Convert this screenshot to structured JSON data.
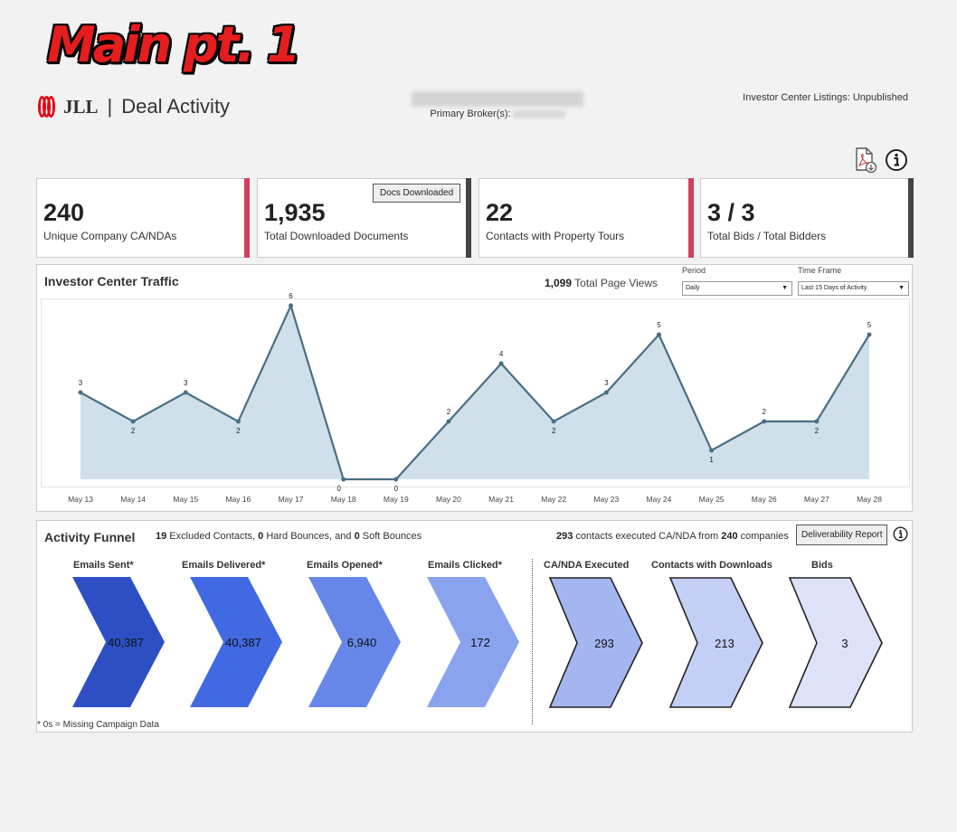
{
  "banner": "Main pt. 1",
  "header": {
    "logo_text": "JLL",
    "separator": "|",
    "title": "Deal Activity",
    "broker_label": "Primary Broker(s):",
    "listing_status": "Investor Center Listings: Unpublished"
  },
  "icons": {
    "pdf": "pdf-export-icon",
    "info": "info-icon"
  },
  "kpis": [
    {
      "value": "240",
      "label": "Unique Company CA/NDAs",
      "accent": "#d43f5e"
    },
    {
      "value": "1,935",
      "label": "Total Downloaded Documents",
      "accent": "#444444",
      "button": "Docs Downloaded"
    },
    {
      "value": "22",
      "label": "Contacts with Property Tours",
      "accent": "#d43f5e"
    },
    {
      "value": "3 / 3",
      "label": "Total Bids / Total Bidders",
      "accent": "#444444"
    }
  ],
  "traffic": {
    "title": "Investor Center Traffic",
    "views_value": "1,099",
    "views_label": "Total Page Views",
    "period_label": "Period",
    "period_value": "Daily",
    "timeframe_label": "Time Frame",
    "timeframe_value": "Last 15 Days of Activity"
  },
  "chart_data": {
    "type": "area",
    "x": [
      "May 13",
      "May 14",
      "May 15",
      "May 16",
      "May 17",
      "May 18",
      "May 19",
      "May 20",
      "May 21",
      "May 22",
      "May 23",
      "May 24",
      "May 25",
      "May 26",
      "May 27",
      "May 28"
    ],
    "values": [
      3,
      2,
      3,
      2,
      6,
      0,
      0,
      2,
      4,
      2,
      3,
      5,
      1,
      2,
      2,
      5
    ],
    "ylim": [
      0,
      6
    ],
    "grid": false,
    "line_color": "#4a6f82",
    "fill_color": "#cfe0ea"
  },
  "funnel": {
    "title": "Activity Funnel",
    "exclusions": {
      "excluded": "19",
      "excluded_text": " Excluded Contacts, ",
      "hard": "0",
      "hard_text": " Hard Bounces, and ",
      "soft": "0",
      "soft_text": " Soft Bounces"
    },
    "summary": {
      "contacts": "293",
      "mid_text": " contacts executed CA/NDA from ",
      "companies": "240",
      "end_text": " companies"
    },
    "report_button": "Deliverability Report",
    "footnote": "* 0s = Missing Campaign Data",
    "steps": [
      {
        "label": "Emails Sent*",
        "value": "40,387",
        "color": "#2e4fc4"
      },
      {
        "label": "Emails Delivered*",
        "value": "40,387",
        "color": "#4169e1"
      },
      {
        "label": "Emails Opened*",
        "value": "6,940",
        "color": "#6787e8"
      },
      {
        "label": "Emails Clicked*",
        "value": "172",
        "color": "#8aa3ef"
      },
      {
        "label": "CA/NDA Executed",
        "value": "293",
        "color": "#a4b6f0"
      },
      {
        "label": "Contacts with Downloads",
        "value": "213",
        "color": "#c3cff5"
      },
      {
        "label": "Bids",
        "value": "3",
        "color": "#dde2f8"
      }
    ]
  }
}
